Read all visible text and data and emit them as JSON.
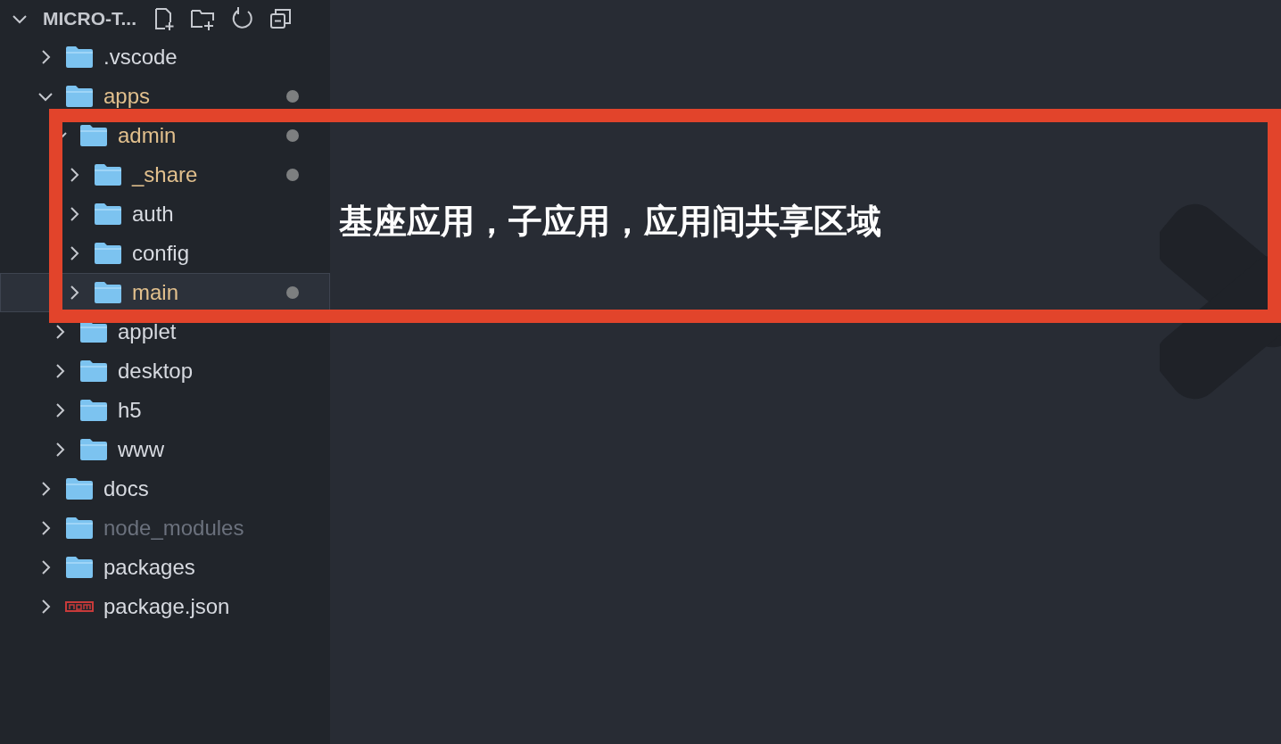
{
  "explorer": {
    "title": "MICRO-T...",
    "expanded": true,
    "tree": [
      {
        "name": ".vscode",
        "kind": "folder",
        "expanded": false,
        "modified": false,
        "ignored": false,
        "selected": false
      },
      {
        "name": "apps",
        "kind": "folder",
        "expanded": true,
        "modified": true,
        "ignored": false,
        "selected": false,
        "children": [
          {
            "name": "admin",
            "kind": "folder",
            "expanded": true,
            "modified": true,
            "ignored": false,
            "selected": false,
            "children": [
              {
                "name": "_share",
                "kind": "folder",
                "expanded": false,
                "modified": true,
                "ignored": false,
                "selected": false
              },
              {
                "name": "auth",
                "kind": "folder",
                "expanded": false,
                "modified": false,
                "ignored": false,
                "selected": false
              },
              {
                "name": "config",
                "kind": "folder",
                "expanded": false,
                "modified": false,
                "ignored": false,
                "selected": false
              },
              {
                "name": "main",
                "kind": "folder",
                "expanded": false,
                "modified": true,
                "ignored": false,
                "selected": true
              }
            ]
          },
          {
            "name": "applet",
            "kind": "folder",
            "expanded": false,
            "modified": false,
            "ignored": false,
            "selected": false
          },
          {
            "name": "desktop",
            "kind": "folder",
            "expanded": false,
            "modified": false,
            "ignored": false,
            "selected": false
          },
          {
            "name": "h5",
            "kind": "folder",
            "expanded": false,
            "modified": false,
            "ignored": false,
            "selected": false
          },
          {
            "name": "www",
            "kind": "folder",
            "expanded": false,
            "modified": false,
            "ignored": false,
            "selected": false
          }
        ]
      },
      {
        "name": "docs",
        "kind": "folder",
        "expanded": false,
        "modified": false,
        "ignored": false,
        "selected": false
      },
      {
        "name": "node_modules",
        "kind": "folder",
        "expanded": false,
        "modified": false,
        "ignored": true,
        "selected": false
      },
      {
        "name": "packages",
        "kind": "folder",
        "expanded": false,
        "modified": false,
        "ignored": false,
        "selected": false
      },
      {
        "name": "package.json",
        "kind": "npm",
        "expanded": false,
        "modified": false,
        "ignored": false,
        "selected": false
      }
    ]
  },
  "annotation": {
    "text": "基座应用，子应用，应用间共享区域"
  }
}
